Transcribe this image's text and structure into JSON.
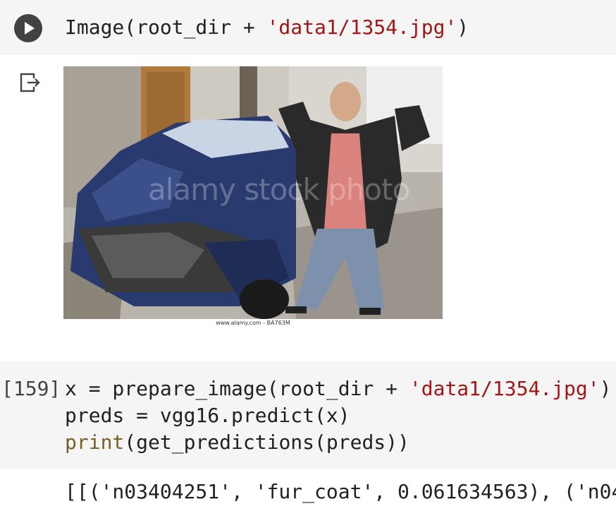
{
  "cell1": {
    "code_prefix": "Image(root_dir + ",
    "code_string": "'data1/1354.jpg'",
    "code_suffix": ")"
  },
  "output1": {
    "image_credit": "www.alamy.com - BA763M",
    "watermark": "alamy stock photo"
  },
  "cell2": {
    "execution_count": "[159]",
    "line1_prefix": "x = prepare_image(root_dir + ",
    "line1_string": "'data1/1354.jpg'",
    "line1_suffix": ")",
    "line2": "preds = vgg16.predict(x)",
    "line3_builtin": "print",
    "line3_rest": "(get_predictions(preds))"
  },
  "output2": {
    "text": "[[('n03404251', 'fur_coat', 0.061634563), ('n04"
  },
  "icons": {
    "run": "play-icon",
    "output": "output-redirect-icon"
  }
}
